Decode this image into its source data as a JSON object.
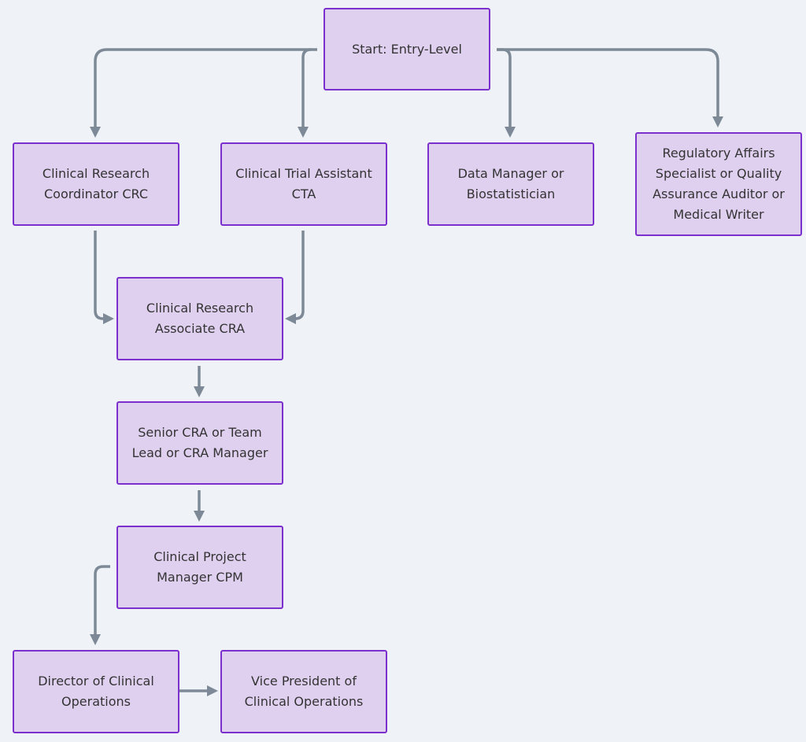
{
  "diagram": {
    "colors": {
      "background": "#eff3f7",
      "node_fill": "#e0d0f0",
      "node_border": "#7b2fcc",
      "edge": "#7d8996",
      "text": "#333333"
    },
    "nodes": {
      "start": "Start: Entry-Level",
      "crc": "Clinical Research Coordinator CRC",
      "cta": "Clinical Trial Assistant CTA",
      "dm": "Data Manager or Biostatistician",
      "ra": "Regulatory Affairs Specialist or Quality Assurance Auditor or Medical Writer",
      "cra": "Clinical Research Associate CRA",
      "senior": "Senior CRA or Team Lead or CRA Manager",
      "cpm": "Clinical Project Manager CPM",
      "director": "Director of Clinical Operations",
      "vp": "Vice President of Clinical Operations"
    },
    "edges": [
      {
        "from": "start",
        "to": "crc"
      },
      {
        "from": "start",
        "to": "cta"
      },
      {
        "from": "start",
        "to": "dm"
      },
      {
        "from": "start",
        "to": "ra"
      },
      {
        "from": "crc",
        "to": "cra"
      },
      {
        "from": "cta",
        "to": "cra"
      },
      {
        "from": "cra",
        "to": "senior"
      },
      {
        "from": "senior",
        "to": "cpm"
      },
      {
        "from": "cpm",
        "to": "director"
      },
      {
        "from": "director",
        "to": "vp"
      }
    ]
  }
}
